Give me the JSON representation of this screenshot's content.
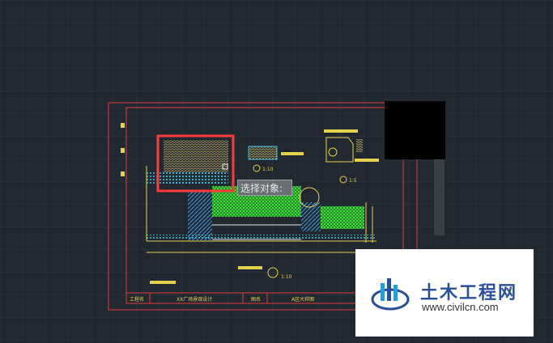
{
  "tooltip": {
    "text": "选择对象:"
  },
  "watermark": {
    "title": "土木工程网",
    "url": "www.civilcn.com"
  },
  "drawing": {
    "labels": [
      "工程名",
      "XX广场景观设计",
      "图名",
      "A区大样图"
    ],
    "scales": [
      "1:10",
      "1:5",
      "1:10"
    ]
  },
  "colors": {
    "background": "#212830",
    "frame": "#e23b3b",
    "green": "#39e639",
    "cyan": "#39c5e6",
    "yellow": "#e6d24a",
    "selection": "#ff3b3b"
  }
}
